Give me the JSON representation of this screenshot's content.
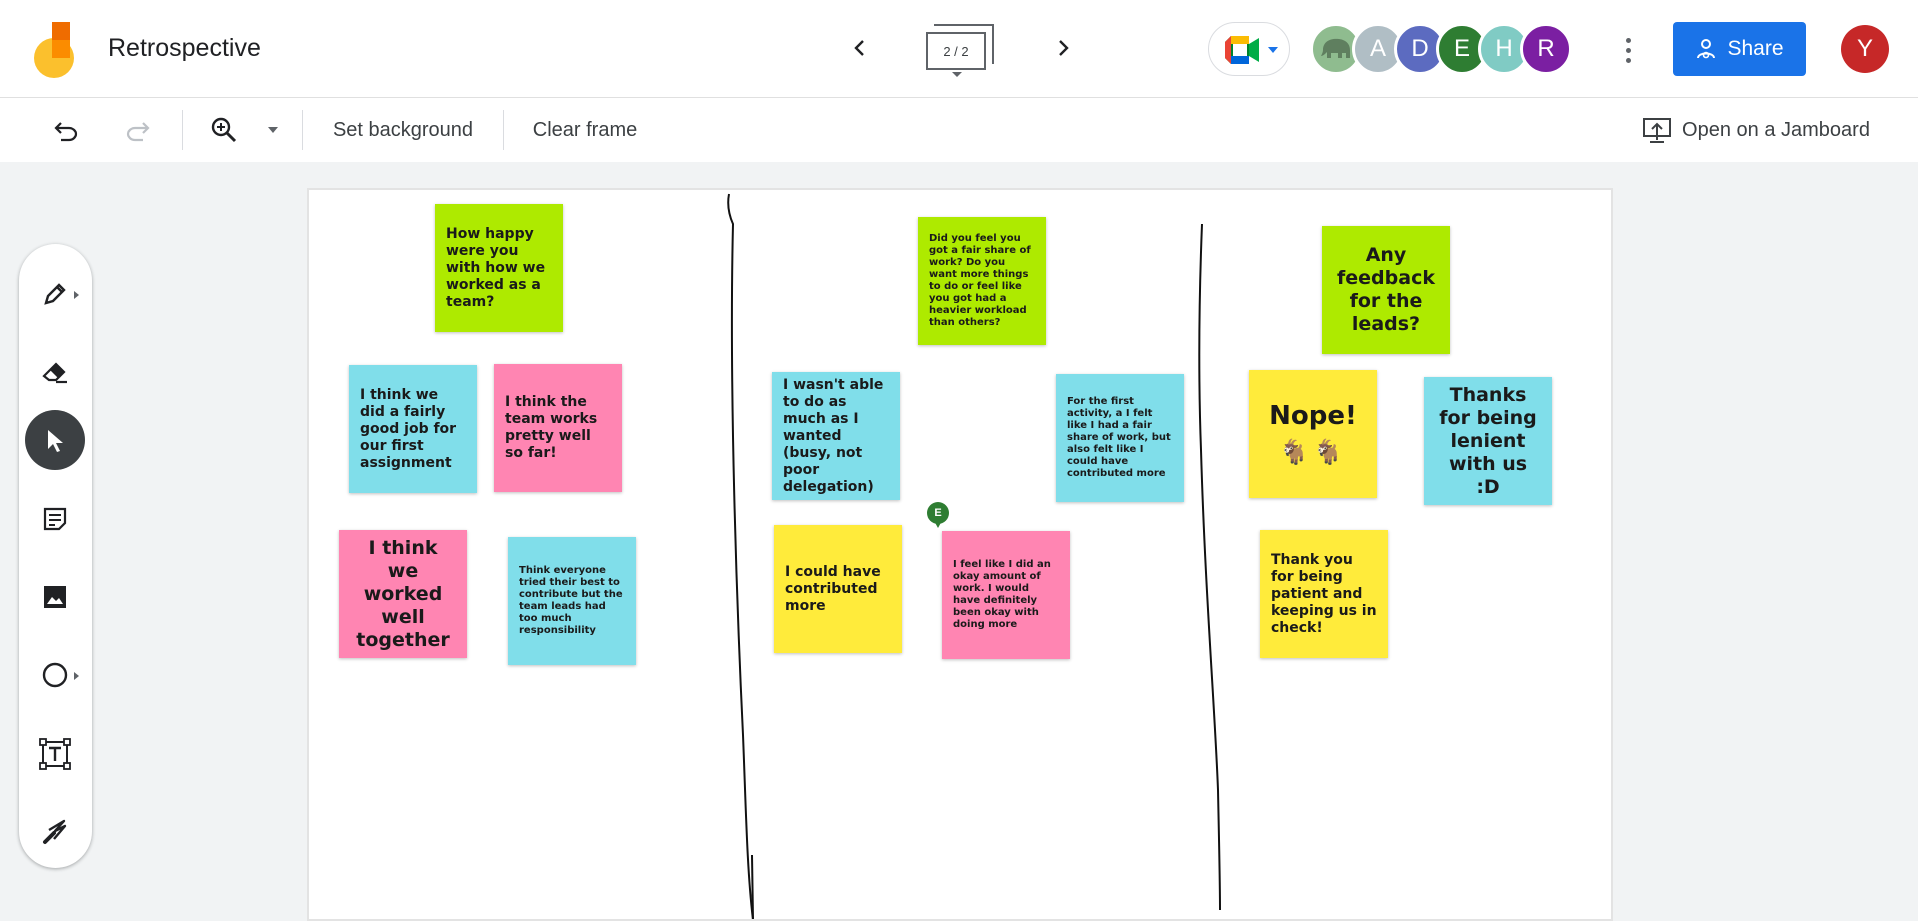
{
  "app": {
    "title": "Retrospective",
    "frame_indicator": "2 / 2"
  },
  "icons": {
    "logo": "jamboard-logo-icon",
    "prev": "chevron-left-icon",
    "next": "chevron-right-icon",
    "meet": "google-meet-icon",
    "more": "more-vert-icon",
    "share": "share-person-icon",
    "undo": "undo-icon",
    "redo": "redo-icon",
    "zoom": "zoom-in-icon",
    "present": "cast-icon"
  },
  "collaborators": [
    {
      "label": "",
      "kind": "elephant",
      "color": "#8fbc8f"
    },
    {
      "label": "A",
      "color": "#b0bec5"
    },
    {
      "label": "D",
      "color": "#5c6bc0"
    },
    {
      "label": "E",
      "color": "#2e7d32"
    },
    {
      "label": "H",
      "color": "#80cbc4"
    },
    {
      "label": "R",
      "color": "#7b1fa2"
    }
  ],
  "share": {
    "label": "Share"
  },
  "current_user": {
    "initial": "Y",
    "color": "#c62828"
  },
  "toolbar": {
    "set_background": "Set background",
    "clear_frame": "Clear frame",
    "open_on_jamboard": "Open on a Jamboard"
  },
  "tools": [
    "pen",
    "eraser",
    "select",
    "sticky-note",
    "image",
    "shape",
    "text-box",
    "laser"
  ],
  "notes": {
    "q1": "How happy were you with how we worked as a team?",
    "a1": "I think we did a fairly good job for our first assignment",
    "a2": "I think the team works pretty well so far!",
    "a3": "I think we worked well together",
    "a4": "Think everyone tried their best to contribute but the team leads had too much responsibility",
    "q2": "Did you feel you got a fair share of work? Do you want more things to do or feel like you got had a heavier workload than others?",
    "b1": "I wasn't able to do as much as I wanted (busy, not poor delegation)",
    "b2": "For the first activity, a I felt like I had a fair share of work, but also felt like I could have contributed more",
    "b3": "I could have contributed more",
    "b4": "I feel like I did an okay amount of work. I would have definitely been okay with doing more",
    "q3": "Any feedback for the leads?",
    "c1": "Nope!",
    "c1_emoji": "🐐🐐",
    "c2": "Thanks for being lenient with us :D",
    "c3": "Thank you for being patient and keeping us in check!"
  },
  "cursor_marker": {
    "label": "E"
  }
}
